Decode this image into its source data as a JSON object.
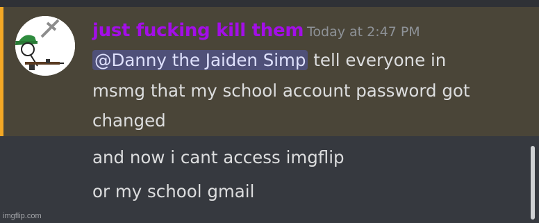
{
  "message_group": {
    "author": {
      "name": "just fucking kill them",
      "name_color": "#a30ee8",
      "avatar": "stick-figure-soldier-avatar"
    },
    "timestamp": "Today at 2:47 PM",
    "highlight_color": "#f3a825",
    "first_message": {
      "mention": "@Danny the Jaiden Simp",
      "line1_text": " tell everyone in",
      "line2": "msmg that my school account password got",
      "line3": "changed"
    },
    "followups": [
      "and now i cant access imgflip",
      "or my school gmail"
    ]
  },
  "watermark": "imgflip.com"
}
